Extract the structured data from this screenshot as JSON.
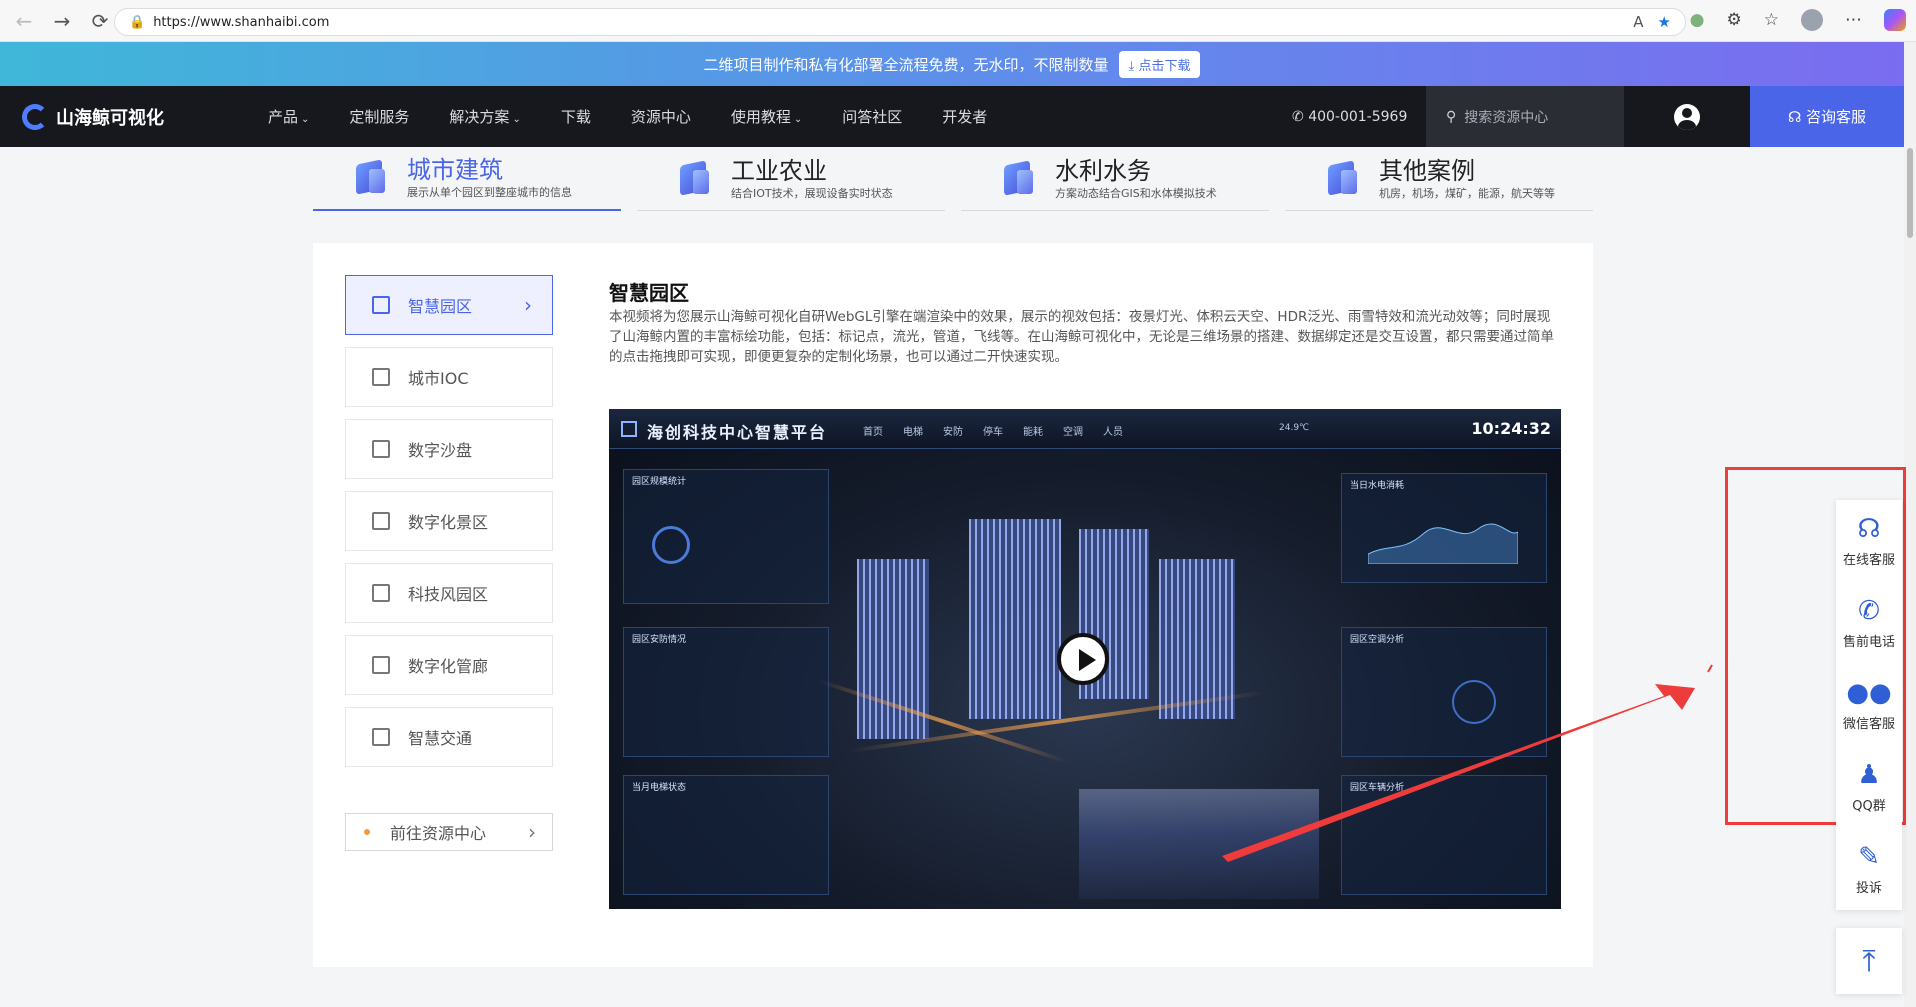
{
  "browser": {
    "url": "https://www.shanhaibi.com"
  },
  "promo": {
    "text": "二维项目制作和私有化部署全流程免费，无水印，不限制数量",
    "button": "点击下载"
  },
  "header": {
    "logo": "山海鲸可视化",
    "menu": [
      {
        "label": "产品",
        "chevron": true
      },
      {
        "label": "定制服务",
        "chevron": false
      },
      {
        "label": "解决方案",
        "chevron": true
      },
      {
        "label": "下载",
        "chevron": false
      },
      {
        "label": "资源中心",
        "chevron": false
      },
      {
        "label": "使用教程",
        "chevron": true
      },
      {
        "label": "问答社区",
        "chevron": false
      },
      {
        "label": "开发者",
        "chevron": false
      }
    ],
    "phone": "400-001-5969",
    "search_placeholder": "搜索资源中心",
    "consult": "咨询客服"
  },
  "categories": [
    {
      "title": "城市建筑",
      "subtitle": "展示从单个园区到整座城市的信息",
      "active": true
    },
    {
      "title": "工业农业",
      "subtitle": "结合IOT技术，展现设备实时状态",
      "active": false
    },
    {
      "title": "水利水务",
      "subtitle": "方案动态结合GIS和水体模拟技术",
      "active": false
    },
    {
      "title": "其他案例",
      "subtitle": "机房，机场，煤矿，能源，航天等等",
      "active": false
    }
  ],
  "sidebar": {
    "items": [
      {
        "label": "智慧园区",
        "active": true
      },
      {
        "label": "城市IOC",
        "active": false
      },
      {
        "label": "数字沙盘",
        "active": false
      },
      {
        "label": "数字化景区",
        "active": false
      },
      {
        "label": "科技风园区",
        "active": false
      },
      {
        "label": "数字化管廊",
        "active": false
      },
      {
        "label": "智慧交通",
        "active": false
      }
    ],
    "resource_button": "前往资源中心"
  },
  "content": {
    "title": "智慧园区",
    "description": "本视频将为您展示山海鲸可视化自研WebGL引擎在端渲染中的效果，展示的视效包括：夜景灯光、体积云天空、HDR泛光、雨雪特效和流光动效等；同时展现了山海鲸内置的丰富标绘功能，包括：标记点，流光，管道，飞线等。在山海鲸可视化中，无论是三维场景的搭建、数据绑定还是交互设置，都只需要通过简单的点击拖拽即可实现，即便更复杂的定制化场景，也可以通过二开快速实现。"
  },
  "video": {
    "title": "海创科技中心智慧平台",
    "tabs": [
      "首页",
      "电梯",
      "安防",
      "停车",
      "能耗",
      "空调",
      "人员"
    ],
    "time": "10:24:32",
    "weather": "24.9℃",
    "panels": [
      "园区规模统计",
      "园区安防情况",
      "当月电梯状态",
      "当日水电消耗",
      "园区空调分析",
      "园区车辆分析"
    ]
  },
  "float_bar": {
    "items": [
      {
        "label": "在线客服",
        "icon": "headset-icon"
      },
      {
        "label": "售前电话",
        "icon": "phone-icon"
      },
      {
        "label": "微信客服",
        "icon": "wechat-icon"
      },
      {
        "label": "QQ群",
        "icon": "qq-icon"
      },
      {
        "label": "投诉",
        "icon": "complaint-icon"
      }
    ],
    "top_icon": "back-to-top-icon"
  },
  "annotation": {
    "color": "#ee3b3b"
  }
}
